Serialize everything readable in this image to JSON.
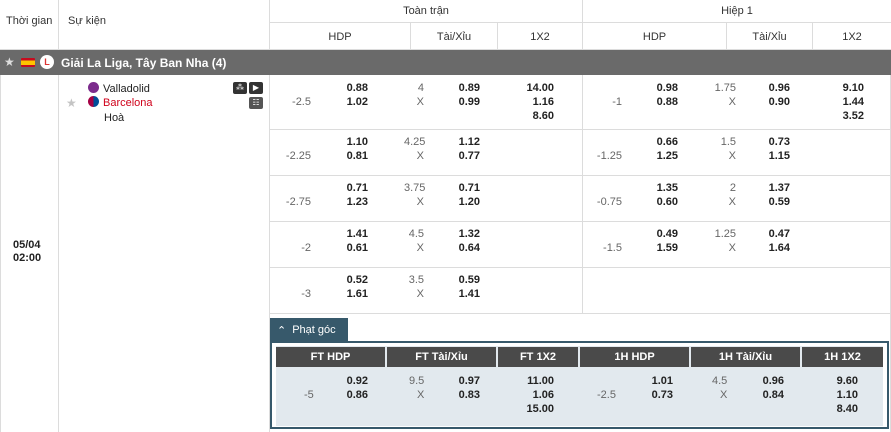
{
  "header": {
    "time_col": "Thời gian",
    "event_col": "Sự kiện",
    "full_match": "Toàn trận",
    "half1": "Hiệp 1",
    "sub": [
      "HDP",
      "Tài/Xỉu",
      "1X2",
      "HDP",
      "Tài/Xỉu",
      "1X2"
    ]
  },
  "league": {
    "name": "Giải La Liga, Tây Ban Nha (4)"
  },
  "match": {
    "date": "05/04",
    "time": "02:00",
    "home": "Valladolid",
    "away": "Barcelona",
    "draw": "Hoà"
  },
  "rows": [
    {
      "ft_hdp_line": "-2.5",
      "ft_hdp_h": "0.88",
      "ft_hdp_a": "1.02",
      "ft_ou_line": "4",
      "ft_ou_x": "X",
      "ft_ou_o": "0.89",
      "ft_ou_u": "0.99",
      "ft_1": "14.00",
      "ft_x": "1.16",
      "ft_2": "8.60",
      "h1_hdp_line": "-1",
      "h1_hdp_h": "0.98",
      "h1_hdp_a": "0.88",
      "h1_ou_line": "1.75",
      "h1_ou_x": "X",
      "h1_ou_o": "0.96",
      "h1_ou_u": "0.90",
      "h1_1": "9.10",
      "h1_x": "1.44",
      "h1_2": "3.52"
    },
    {
      "ft_hdp_line": "-2.25",
      "ft_hdp_h": "1.10",
      "ft_hdp_a": "0.81",
      "ft_ou_line": "4.25",
      "ft_ou_x": "X",
      "ft_ou_o": "1.12",
      "ft_ou_u": "0.77",
      "h1_hdp_line": "-1.25",
      "h1_hdp_h": "0.66",
      "h1_hdp_a": "1.25",
      "h1_ou_line": "1.5",
      "h1_ou_x": "X",
      "h1_ou_o": "0.73",
      "h1_ou_u": "1.15"
    },
    {
      "ft_hdp_line": "-2.75",
      "ft_hdp_h": "0.71",
      "ft_hdp_a": "1.23",
      "ft_ou_line": "3.75",
      "ft_ou_x": "X",
      "ft_ou_o": "0.71",
      "ft_ou_u": "1.20",
      "h1_hdp_line": "-0.75",
      "h1_hdp_h": "1.35",
      "h1_hdp_a": "0.60",
      "h1_ou_line": "2",
      "h1_ou_x": "X",
      "h1_ou_o": "1.37",
      "h1_ou_u": "0.59"
    },
    {
      "ft_hdp_line": "-2",
      "ft_hdp_h": "1.41",
      "ft_hdp_a": "0.61",
      "ft_ou_line": "4.5",
      "ft_ou_x": "X",
      "ft_ou_o": "1.32",
      "ft_ou_u": "0.64",
      "h1_hdp_line": "-1.5",
      "h1_hdp_h": "0.49",
      "h1_hdp_a": "1.59",
      "h1_ou_line": "1.25",
      "h1_ou_x": "X",
      "h1_ou_o": "0.47",
      "h1_ou_u": "1.64"
    },
    {
      "ft_hdp_line": "-3",
      "ft_hdp_h": "0.52",
      "ft_hdp_a": "1.61",
      "ft_ou_line": "3.5",
      "ft_ou_x": "X",
      "ft_ou_o": "0.59",
      "ft_ou_u": "1.41"
    }
  ],
  "corners": {
    "tab": "Phạt góc",
    "headers": [
      "FT HDP",
      "FT Tài/Xỉu",
      "FT 1X2",
      "1H HDP",
      "1H Tài/Xỉu",
      "1H 1X2"
    ],
    "ft_hdp_line": "-5",
    "ft_hdp_h": "0.92",
    "ft_hdp_a": "0.86",
    "ft_ou_line": "9.5",
    "ft_ou_x": "X",
    "ft_ou_o": "0.97",
    "ft_ou_u": "0.83",
    "ft_1": "11.00",
    "ft_x": "1.06",
    "ft_2": "15.00",
    "h1_hdp_line": "-2.5",
    "h1_hdp_h": "1.01",
    "h1_hdp_a": "0.73",
    "h1_ou_line": "4.5",
    "h1_ou_x": "X",
    "h1_ou_o": "0.96",
    "h1_ou_u": "0.84",
    "h1_1": "9.60",
    "h1_x": "1.10",
    "h1_2": "8.40"
  },
  "colors": {
    "league_bar": "#6a6a6a",
    "corner_accent": "#37596b",
    "away_team": "#d0021b"
  }
}
